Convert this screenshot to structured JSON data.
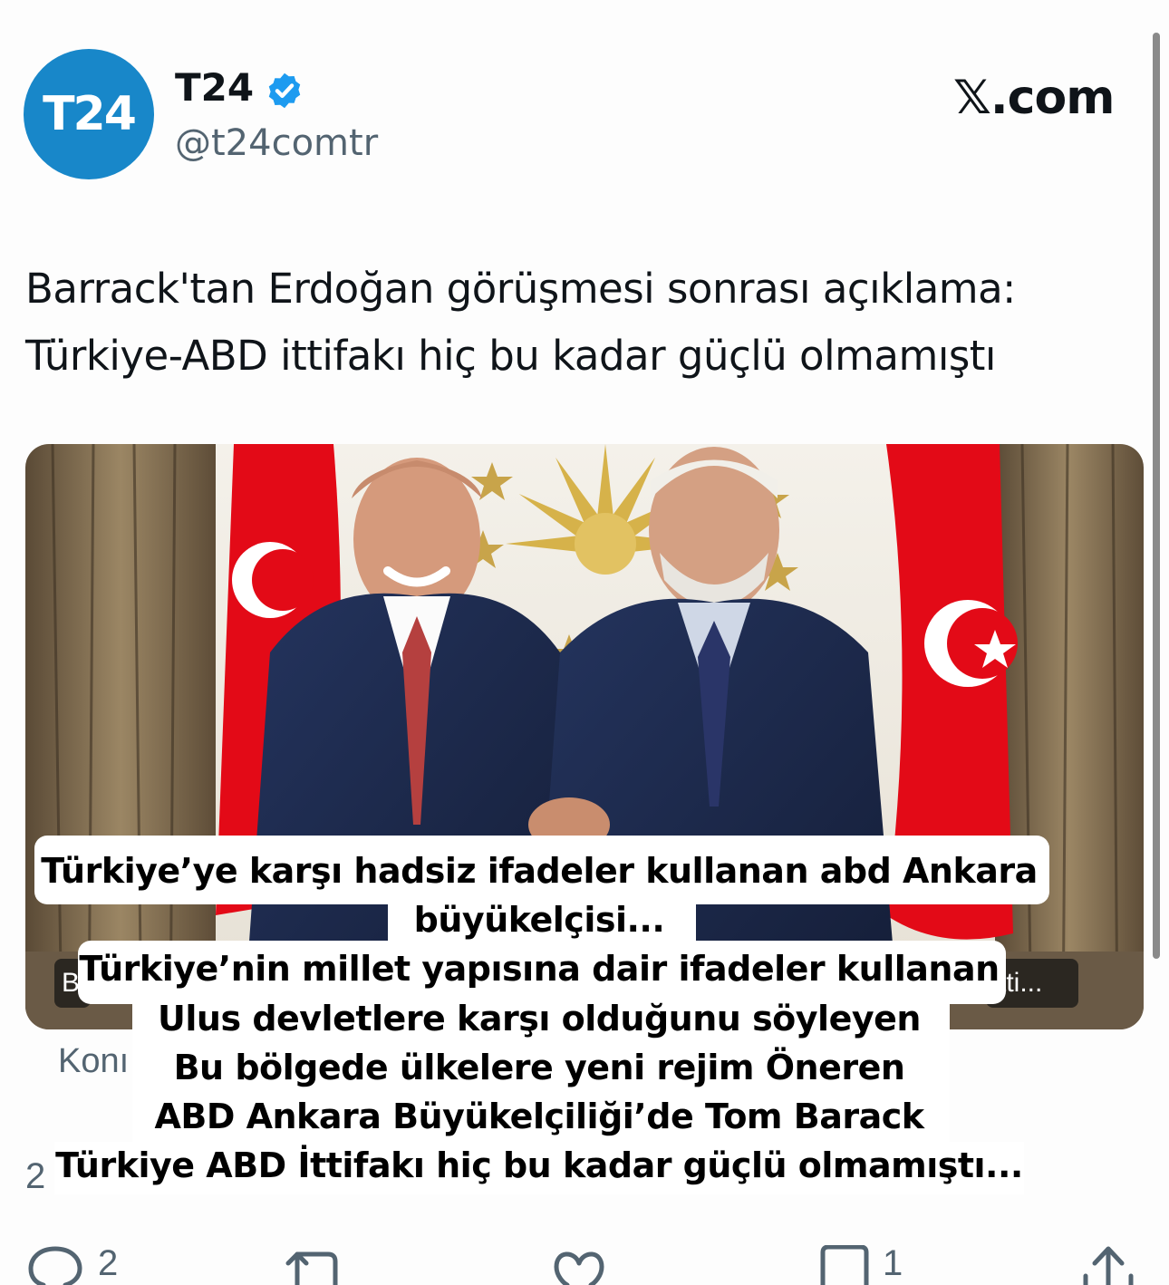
{
  "author": {
    "avatar_text": "T24",
    "display_name": "T24",
    "handle": "@t24comtr",
    "verified": true
  },
  "brand": "𝕏.com",
  "post": {
    "headline_line1": "Barrack'tan Erdoğan görüşmesi sonrası açıklama:",
    "headline_line2": "Türkiye-ABD ittifakı hiç bu kadar güçlü olmamıştı"
  },
  "media_card": {
    "badge_right": "tti...",
    "badge_left": "B"
  },
  "context_text": "Konı",
  "side_count": "2",
  "caption_overlay": [
    "Türkiye’ye karşı hadsiz ifadeler kullanan abd Ankara",
    "büyükelçisi...",
    "Türkiye’nin millet yapısına dair ifadeler kullanan",
    "Ulus devletlere karşı olduğunu söyleyen",
    "Bu bölgede ülkelere yeni rejim Öneren",
    "ABD Ankara Büyükelçiliği’de Tom Barack",
    "Türkiye ABD İttifakı hiç bu kadar güçlü olmamıştı..."
  ],
  "actions": {
    "reply_count": "2",
    "repost_count": "",
    "like_count": "",
    "bookmark_count": "1"
  },
  "colors": {
    "brand_blue": "#1887c9",
    "verified_blue": "#1d9bf0",
    "flag_red": "#e30a17",
    "text_muted": "#536471"
  },
  "icons": [
    "verified-badge-icon",
    "reply-icon",
    "repost-icon",
    "like-icon",
    "bookmark-icon",
    "share-icon"
  ]
}
